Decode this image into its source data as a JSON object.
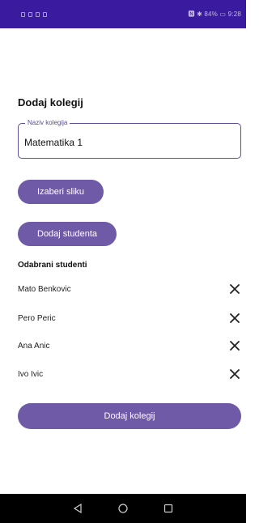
{
  "status_bar": {
    "right_text": "🅽 ✱ 84% ▭ 9:28"
  },
  "page": {
    "title": "Dodaj kolegij"
  },
  "course_name": {
    "label": "Naziv kolegija",
    "value": "Matematika 1"
  },
  "buttons": {
    "choose_image": "Izaberi sliku",
    "add_student": "Dodaj studenta",
    "submit": "Dodaj kolegij"
  },
  "students": {
    "heading": "Odabrani studenti",
    "items": [
      {
        "name": "Mato Benkovic",
        "remove_icon": "close-icon"
      },
      {
        "name": "Pero Peric",
        "remove_icon": "close-icon"
      },
      {
        "name": "Ana Anic",
        "remove_icon": "close-icon"
      },
      {
        "name": "Ivo Ivic",
        "remove_icon": "close-icon"
      }
    ]
  },
  "nav_bar": {
    "icons": [
      "back-icon",
      "home-icon",
      "recents-icon"
    ]
  },
  "colors": {
    "status_bar": "#3a1a9e",
    "accent": "#6f5aa7",
    "field_border": "#5f4f98"
  }
}
